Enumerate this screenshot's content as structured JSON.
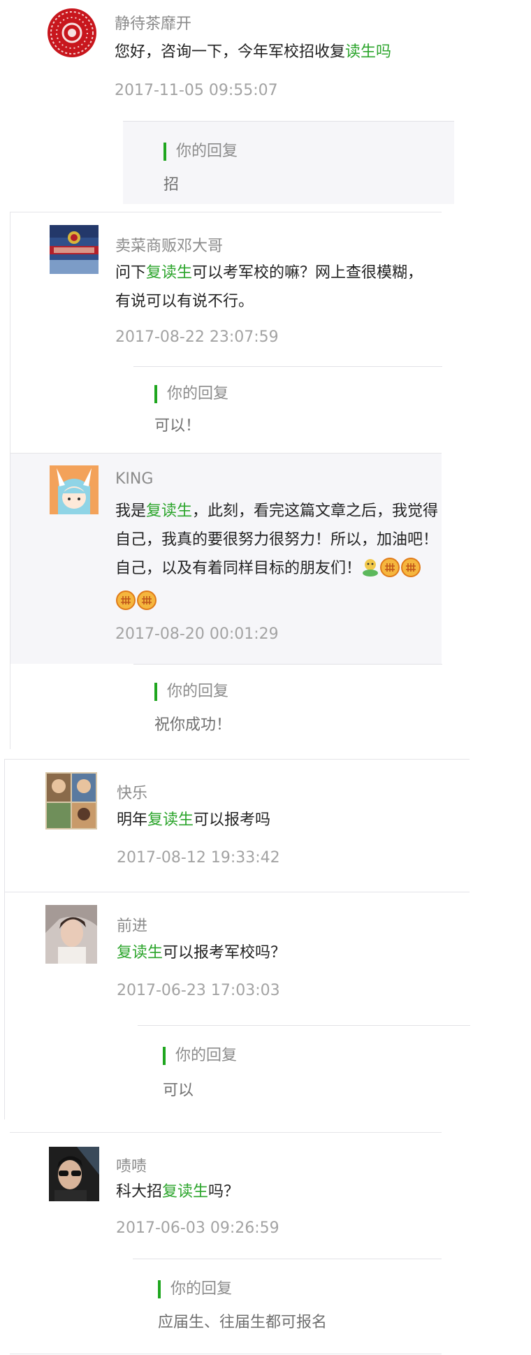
{
  "reply_label": "你的回复",
  "comments": [
    {
      "username": "静待茶靡开",
      "text_before": "您好，咨询一下，今年军校招收复",
      "highlight": "读生吗",
      "text_after": "",
      "time": "2017-11-05 09:55:07",
      "reply": "招",
      "avatar": "red-seal-avatar"
    },
    {
      "username": "卖菜商贩邓大哥",
      "text_before": "问下",
      "highlight": "复读生",
      "text_after": "可以考军校的嘛？网上查很模糊，有说可以有说不行。",
      "time": "2017-08-22 23:07:59",
      "reply": "可以！",
      "avatar": "police-cap-avatar"
    },
    {
      "username": "KING",
      "text_before": "我是",
      "highlight": "复读生",
      "text_after": "，此刻，看完这篇文章之后，我觉得自己，我真的要很努力很努力！所以，加油吧！自己，以及有着同样目标的朋友们！",
      "time": "2017-08-20 00:01:29",
      "reply": "祝你成功！",
      "avatar": "anime-girl-avatar",
      "emojis": [
        "cheer-emoji",
        "fist-emoji",
        "fist-emoji",
        "fist-emoji",
        "fist-emoji"
      ]
    },
    {
      "username": "快乐",
      "text_before": "明年",
      "highlight": "复读生",
      "text_after": "可以报考吗",
      "time": "2017-08-12 19:33:42",
      "reply": "",
      "avatar": "photo-collage-avatar"
    },
    {
      "username": "前进",
      "text_before": "",
      "highlight": "复读生",
      "text_after": "可以报考军校吗？",
      "time": "2017-06-23 17:03:03",
      "reply": "可以",
      "avatar": "portrait-avatar"
    },
    {
      "username": "啧啧",
      "text_before": "科大招",
      "highlight": "复读生",
      "text_after": "吗？",
      "time": "2017-06-03 09:26:59",
      "reply": "应届生、往届生都可报名",
      "avatar": "sunglasses-avatar"
    }
  ]
}
